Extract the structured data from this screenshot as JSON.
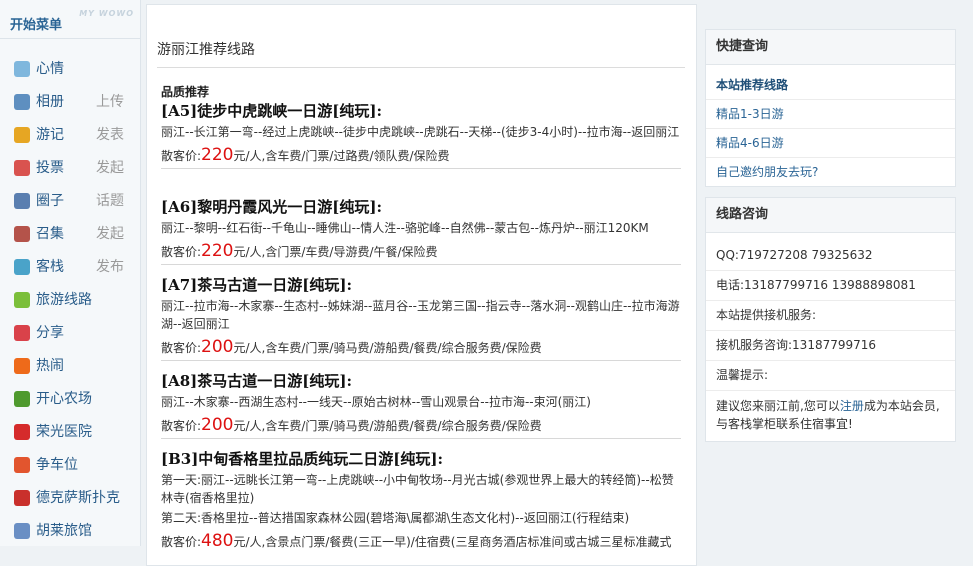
{
  "sidebar": {
    "title": "开始菜单",
    "watermark": "MY WOWO",
    "items": [
      {
        "label": "心情",
        "sub": "",
        "icon": "chat-bubble-icon",
        "color": "#7fb7dd"
      },
      {
        "label": "相册",
        "sub": "上传",
        "icon": "photo-album-icon",
        "color": "#5e8fc0"
      },
      {
        "label": "游记",
        "sub": "发表",
        "icon": "notebook-icon",
        "color": "#e6a623"
      },
      {
        "label": "投票",
        "sub": "发起",
        "icon": "bar-chart-icon",
        "color": "#d9534f"
      },
      {
        "label": "圈子",
        "sub": "话题",
        "icon": "people-circle-icon",
        "color": "#5a7fb0"
      },
      {
        "label": "召集",
        "sub": "发起",
        "icon": "calendar-icon",
        "color": "#b4534a"
      },
      {
        "label": "客栈",
        "sub": "发布",
        "icon": "inn-people-icon",
        "color": "#4aa3c9"
      },
      {
        "label": "旅游线路",
        "sub": "",
        "icon": "tree-icon",
        "color": "#7bbf3a"
      },
      {
        "label": "分享",
        "sub": "",
        "icon": "heart-share-icon",
        "color": "#d9424a"
      },
      {
        "label": "热闹",
        "sub": "",
        "icon": "fire-icon",
        "color": "#ee6a1a"
      },
      {
        "label": "开心农场",
        "sub": "",
        "icon": "sprout-icon",
        "color": "#4f9a2e"
      },
      {
        "label": "荣光医院",
        "sub": "",
        "icon": "red-cross-icon",
        "color": "#d52b2b"
      },
      {
        "label": "争车位",
        "sub": "",
        "icon": "parking-icon",
        "color": "#e2552e"
      },
      {
        "label": "德克萨斯扑克",
        "sub": "",
        "icon": "poker-chip-icon",
        "color": "#c9302c"
      },
      {
        "label": "胡莱旅馆",
        "sub": "",
        "icon": "hotel-icon",
        "color": "#6a8fc4"
      }
    ]
  },
  "main": {
    "title": "游丽江推荐线路",
    "section_label": "品质推荐",
    "price_prefix": "散客价:",
    "routes": [
      {
        "title": "[A5]徒步中虎跳峡一日游[纯玩]:",
        "desc": "丽江--长江第一弯--经过上虎跳峡--徒步中虎跳峡--虎跳石--天梯--(徒步3-4小时)--拉市海--返回丽江",
        "price": "220",
        "price_suffix": "元/人,含车费/门票/过路费/领队费/保险费"
      },
      {
        "title": "[A6]黎明丹霞风光一日游[纯玩]:",
        "desc": "丽江--黎明--红石街--千龟山--睡佛山--情人泩--骆驼峰--自然佛--蒙古包--炼丹炉--丽江120KM",
        "price": "220",
        "price_suffix": "元/人,含门票/车费/导游费/午餐/保险费"
      },
      {
        "title": "[A7]茶马古道一日游[纯玩]:",
        "desc": "丽江--拉市海--木家寨--生态村--姊妹湖--蓝月谷--玉龙第三国--指云寺--落水洞--观鹤山庄--拉市海游湖--返回丽江",
        "price": "200",
        "price_suffix": "元/人,含车费/门票/骑马费/游船费/餐费/综合服务费/保险费"
      },
      {
        "title": "[A8]茶马古道一日游[纯玩]:",
        "desc": "丽江--木家寨--西湖生态村--一线天--原始古树林--雪山观景台--拉市海--束河(丽江)",
        "price": "200",
        "price_suffix": "元/人,含车费/门票/骑马费/游船费/餐费/综合服务费/保险费"
      },
      {
        "title": "[B3]中甸香格里拉品质纯玩二日游[纯玩]:",
        "desc": "第一天:丽江--远眺长江第一弯--上虎跳峡--小中甸牧场--月光古城(参观世界上最大的转经筒)--松赞林寺(宿香格里拉)",
        "desc2": "第二天:香格里拉--普达措国家森林公园(碧塔海\\属都湖\\生态文化村)--返回丽江(行程结束)",
        "price": "480",
        "price_suffix": "元/人,含景点门票/餐费(三正一早)/住宿费(三星商务酒店标准间或古城三星标准藏式"
      }
    ]
  },
  "quick_search": {
    "title": "快捷查询",
    "links": [
      "本站推荐线路",
      "精品1-3日游",
      "精品4-6日游",
      "自己邀约朋友去玩?"
    ]
  },
  "consult": {
    "title": "线路咨询",
    "rows": [
      "QQ:719727208 79325632",
      "电话:13187799716 13988898081",
      "本站提供接机服务:",
      "接机服务咨询:13187799716",
      "温馨提示:"
    ],
    "tip_before": "建议您来丽江前,您可以",
    "tip_link": "注册",
    "tip_after": "成为本站会员,与客栈掌柜联系住宿事宜!"
  }
}
